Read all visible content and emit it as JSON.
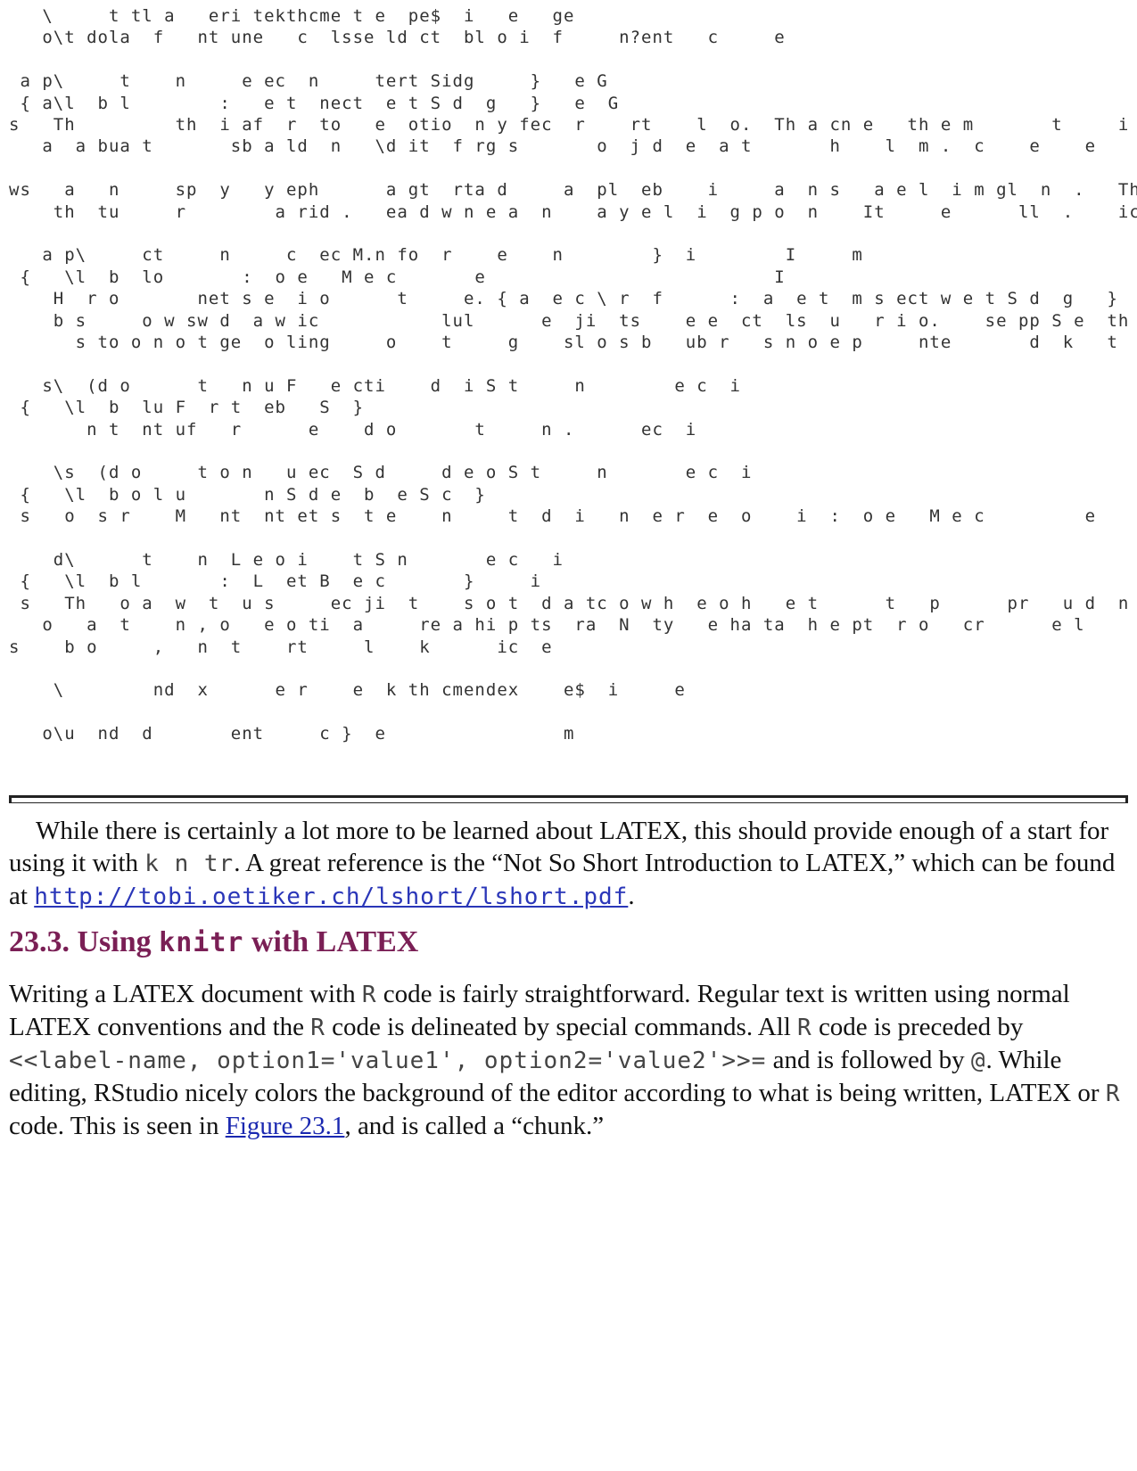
{
  "code_lines": [
    "   \\     t tl a   eri tekthcme t e  pe$  i   e   ge",
    "   o\\t dola  f   nt une   c  lsse ld ct  bl o i  f     n?ent   c     e",
    "",
    " a p\\     t    n     e ec  n     tert Sidg     }   e G",
    " { a\\l  b l        :   e t  nect  e t S d  g   }   e  G",
    "s   Th         th  i af  r  to   e  otio  n y fec  r    rt    l  o.  Th a cn e   th e m       t     i lgtil   i                     k",
    "   a  a bua t       sb a ld  n   \\d it  f rg s       o  j d  e  a t       h    l  m .  c    e    e      m",
    "",
    "ws   a   n     sp  y   y eph      a gt  rta d     a  pl  eb    i     a  n s   a e l  i m gl  n  .   Th  ti  e kll     i",
    "    th  tu     r        a rid .   ea d w n e a  n    a y e l  i  g p o  n    It     e      ll  .    ic              m",
    "",
    "   a p\\     ct     n     c  ec M.n fo  r    e    n        }  i        I     m",
    " {   \\l  b  lo       :  o e   M e c       e                          I",
    "    H  r o       net s e  i o      t     e. { a  e c \\ r  f      :  a  e t  m s ect w e t S d  g   }  l  e o  G  de      e       e          e                    m",
    "    b s     o w sw d  a w ic           lul      e  ji  ts    e e  ct  ls  u   r i o.    se pp S e  th   o     e  t     n       ec  i     i",
    "      s to o n o t ge  o ling     o    t     g    sl o s b   ub r   s n o e p     nte       d  k   t     n  .  ec  i",
    "",
    "   s\\  (d o      t   n u F   e cti    d  i S t     n        e c  i",
    " {   \\l  b  lu F  r t  eb   S  }",
    "       n t  nt uf   r      e    d o       t     n .      ec  i",
    "",
    "    \\s  (d o     t o n   u ec  S d     d e o S t     n       e c  i",
    " {   \\l  b o l u       n S d e  b  e S c  }",
    " s   o  s r    M   nt  nt et s  t e    n     t  d  i   n  e r  e  o    i  :  o e   M e c         e                         I",
    "",
    "    d\\      t    n  L e o i    t S n       e c   i",
    " {   \\l  b l       :  L  et B  e c       }     i",
    " s   Th   o a  w  t  u s     ec ji  t    s o t  d a tc o w h  e o h   e t      t   p      pr   u d  n  -  e b e  i  g",
    "   o   a  t    n , o   e o ti  a     re a hi p ts  ra  N  ty   e ha ta  h e pt  r o   cr      e l      ve  l  bl       ni         e  i",
    "s    b o     ,   n  t    rt     l    k      ic  e",
    "",
    "    \\        nd  x      e r    e  k th cmendex    e$  i     e",
    "",
    "   o\\u  nd  d       ent     c }  e                m"
  ],
  "p1": {
    "text_a": "While there is certainly a lot more to be learned about LATEX, this should provide enough of a start for using it with ",
    "mono_a": "k n tr",
    "text_b": ". A great reference is the “Not So Short Introduction to LATEX,” which can be found at ",
    "link": "http://tobi.oetiker.ch/lshort/lshort.pdf",
    "text_c": "."
  },
  "heading": {
    "number": "23.3.",
    "text_a": " Using ",
    "mono": "knitr",
    "text_b": " with LATEX"
  },
  "p2": {
    "t1": "Writing a LATEX document with ",
    "r1": "R",
    "t2": " code is fairly straightforward. Regular text is written using normal LATEX conventions and the ",
    "r2": "R",
    "t3": " code is delineated by special commands. All ",
    "r3": "R",
    "t4": " code is preceded by ",
    "code": "<<label-name, option1='value1', option2='value2'>>=",
    "t5": " and is followed by ",
    "at": "@",
    "t6": ". While editing, RStudio nicely colors the background of the editor according to what is being written, LATEX or ",
    "r4": "R",
    "t7": " code. This is seen in ",
    "fig_link": "Figure 23.1",
    "t8": ", and is called a “chunk.”"
  }
}
